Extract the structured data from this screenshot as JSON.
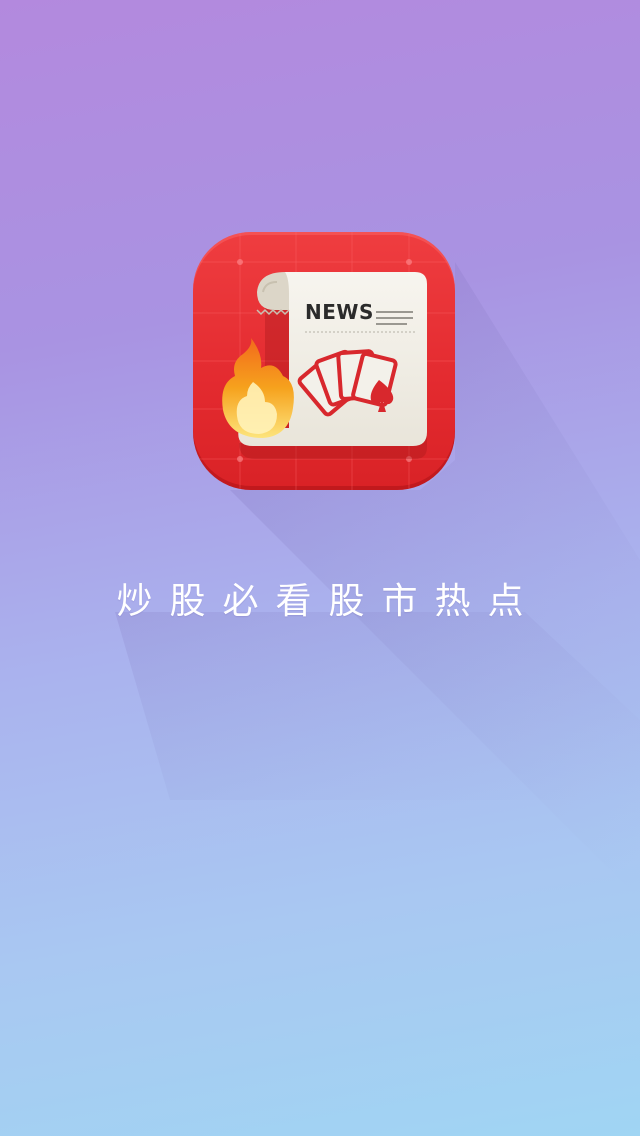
{
  "splash": {
    "icon": {
      "name": "news-icon",
      "badge_text": "NEWS",
      "colors": {
        "background": "#e53034",
        "paper": "#f3f1ea",
        "flame_outer": "#f5a623",
        "flame_inner": "#fde58a",
        "cards": "#d8282d"
      }
    },
    "slogan": "炒股必看股市热点",
    "colors": {
      "gradient_top": "#b389de",
      "gradient_bottom": "#a0d5f3",
      "slogan_text": "#ffffff"
    }
  }
}
